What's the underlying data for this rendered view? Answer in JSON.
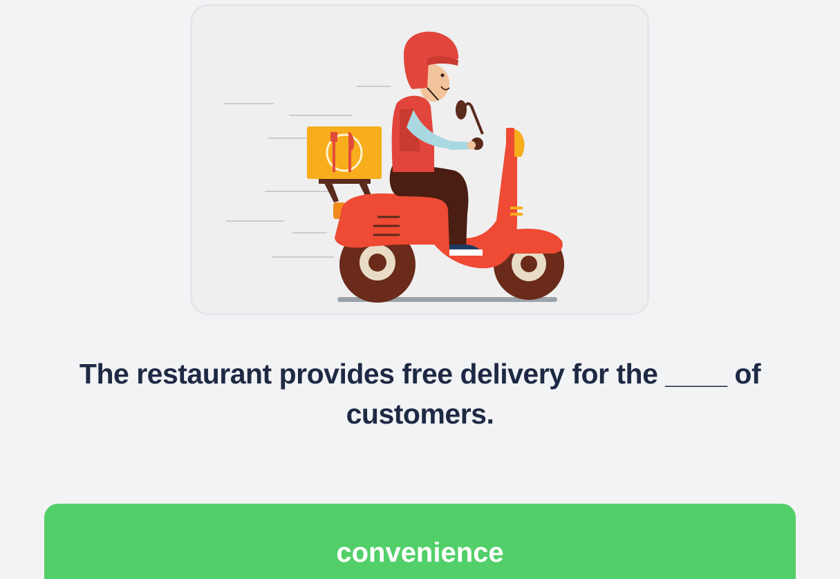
{
  "illustration": {
    "subject": "delivery-scooter-rider"
  },
  "question": {
    "text": "The restaurant provides free delivery for the ____ of customers."
  },
  "answers": [
    {
      "label": "convenience"
    }
  ],
  "colors": {
    "background": "#f2f3f5",
    "question_text": "#1e2a44",
    "answer_button": "#52cf69",
    "answer_text": "#ffffff"
  }
}
